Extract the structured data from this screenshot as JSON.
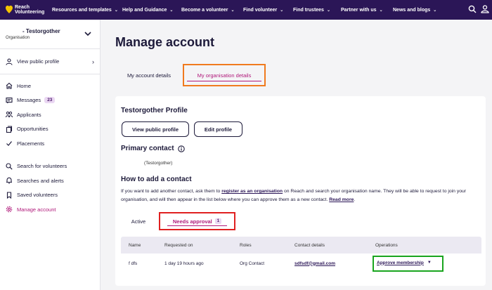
{
  "nav": {
    "brand_line1": "Reach",
    "brand_line2": "Volunteering",
    "items": [
      {
        "label": "Resources and templates"
      },
      {
        "label": "Help and Guidance"
      },
      {
        "label": "Become a volunteer"
      },
      {
        "label": "Find volunteer"
      },
      {
        "label": "Find trustees"
      },
      {
        "label": "Partner with us"
      },
      {
        "label": "News and blogs"
      }
    ],
    "chevron": "⌄"
  },
  "sidebar": {
    "org_name": "- Testorgother",
    "org_type": "Organisation",
    "view_public_profile": "View public profile",
    "items": [
      {
        "label": "Home",
        "icon": "home-icon"
      },
      {
        "label": "Messages",
        "icon": "messages-icon",
        "badge": "23"
      },
      {
        "label": "Applicants",
        "icon": "applicants-icon"
      },
      {
        "label": "Opportunities",
        "icon": "opportunities-icon"
      },
      {
        "label": "Placements",
        "icon": "check-icon"
      },
      {
        "label": "Search for volunteers",
        "icon": "search-icon"
      },
      {
        "label": "Searches and alerts",
        "icon": "bell-icon"
      },
      {
        "label": "Saved volunteers",
        "icon": "bookmark-icon"
      },
      {
        "label": "Manage account",
        "icon": "gear-icon",
        "active": true
      }
    ]
  },
  "main": {
    "title": "Manage account",
    "tabs": [
      {
        "label": "My account details"
      },
      {
        "label": "My organisation details",
        "selected": true
      }
    ],
    "profile_title": "Testorgother Profile",
    "view_public_profile_button": "View public profile",
    "edit_profile_button": "Edit profile",
    "primary_contact_title": "Primary contact",
    "primary_contact_name": "(Testorgother)",
    "how_title": "How to add a contact",
    "how_text_1": "If you want to add another contact, ask them to ",
    "how_link_1": "register as an organisation",
    "how_text_2": " on Reach and search your organisation name. They will be able to request to join your organisation, and will then appear in the list below where you can approve them as a new contact. ",
    "how_link_2": "Read more",
    "how_text_3": ".",
    "subtabs": {
      "active_label": "Active",
      "needs_approval_label": "Needs approval",
      "needs_approval_count": "1"
    },
    "table": {
      "headers": [
        "Name",
        "Requested on",
        "Roles",
        "Contact details",
        "Operations"
      ],
      "rows": [
        {
          "name": "f dfs",
          "requested_on": "1 day 19 hours ago",
          "roles": "Org Contact",
          "contact": "sdfsdf@gmail.com",
          "operation": "Approve membership"
        }
      ]
    }
  },
  "colors": {
    "nav_bg": "#2b1657",
    "accent": "#b0197a",
    "highlight_orange": "#f07a1e",
    "highlight_red": "#e02020",
    "highlight_green": "#19a51e"
  }
}
